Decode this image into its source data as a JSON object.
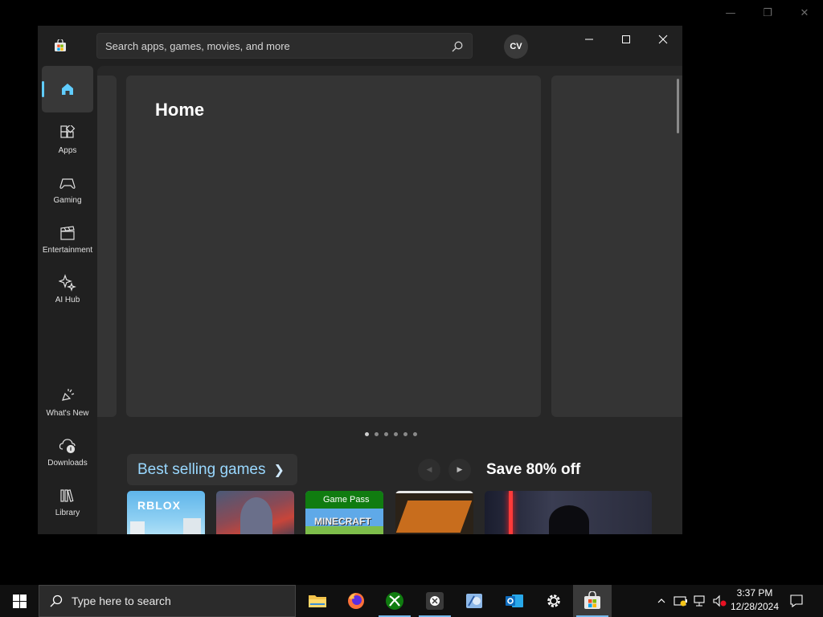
{
  "store": {
    "search_placeholder": "Search apps, games, movies, and more",
    "account_initials": "CV",
    "nav": [
      {
        "label": "",
        "icon": "home-icon"
      },
      {
        "label": "Apps",
        "icon": "apps-icon"
      },
      {
        "label": "Gaming",
        "icon": "gamepad-icon"
      },
      {
        "label": "Entertainment",
        "icon": "clapperboard-icon"
      },
      {
        "label": "AI Hub",
        "icon": "sparkle-icon"
      },
      {
        "label": "What's New",
        "icon": "megaphone-icon"
      },
      {
        "label": "Downloads",
        "icon": "downloads-icon"
      },
      {
        "label": "Library",
        "icon": "library-icon"
      }
    ],
    "hero_title": "Home",
    "carousel": {
      "count": 6,
      "active": 0
    },
    "section_title": "Best selling games",
    "promo_title": "Save 80% off",
    "tiles": [
      {
        "name": "roblox",
        "label": "RBLOX"
      },
      {
        "name": "fighter-game",
        "label": ""
      },
      {
        "name": "minecraft",
        "badge": "Game Pass",
        "label": "MINECRAFT"
      },
      {
        "name": "call-of-duty",
        "label": ""
      },
      {
        "name": "star-wars",
        "label": ""
      }
    ]
  },
  "taskbar": {
    "search_placeholder": "Type here to search",
    "apps": [
      "file-explorer-icon",
      "firefox-icon",
      "xbox-icon",
      "xbox-app-icon",
      "snipping-icon",
      "outlook-icon",
      "settings-icon",
      "microsoft-store-icon"
    ],
    "time": "3:37 PM",
    "date": "12/28/2024"
  },
  "colors": {
    "accent": "#60cdff",
    "link": "#99d8ff",
    "window_bg": "#202020",
    "content_bg": "#272727"
  }
}
